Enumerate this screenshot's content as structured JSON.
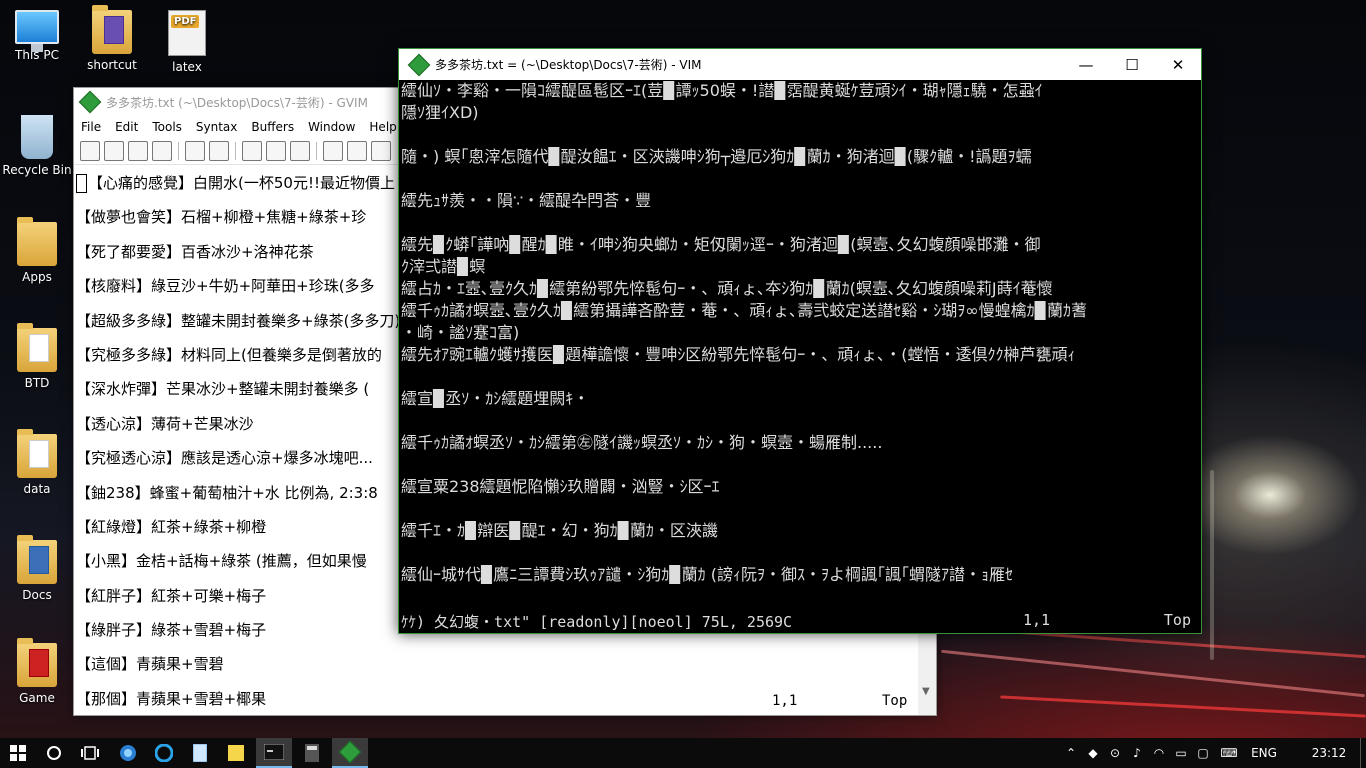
{
  "desktop": {
    "icons": [
      {
        "label": "This PC"
      },
      {
        "label": "shortcut"
      },
      {
        "label": "latex"
      },
      {
        "label": "Recycle Bin"
      },
      {
        "label": "Apps"
      },
      {
        "label": "BTD"
      },
      {
        "label": "data"
      },
      {
        "label": "Docs"
      },
      {
        "label": "Game"
      }
    ],
    "pdf_badge": "PDF"
  },
  "gvim": {
    "title": "多多茶坊.txt (~\\Desktop\\Docs\\7-芸術) - GVIM",
    "menu": [
      "File",
      "Edit",
      "Tools",
      "Syntax",
      "Buffers",
      "Window",
      "Help"
    ],
    "lines": [
      "【心痛的感覺】白開水(一杯50元!!最近物價上",
      "【做夢也會笑】石榴+柳橙+焦糖+綠茶+珍",
      "【死了都要愛】百香冰沙+洛神花茶",
      "【核廢料】綠豆沙+牛奶+阿華田+珍珠(多多",
      "【超級多多綠】整罐未開封養樂多+綠茶(多多刀)",
      "【究極多多綠】材料同上(但養樂多是倒著放的",
      "【深水炸彈】芒果冰沙+整罐未開封養樂多 (",
      "【透心涼】薄荷+芒果冰沙",
      "【究極透心涼】應該是透心涼+爆多冰塊吧...",
      "【鈾238】蜂蜜+葡萄柚汁+水 比例為, 2:3:8",
      "【紅綠燈】紅茶+綠茶+柳橙",
      "【小黑】金桔+話梅+綠茶 (推薦，但如果慢",
      "【紅胖子】紅茶+可樂+梅子",
      "【綠胖子】綠茶+雪碧+梅子",
      "【這個】青蘋果+雪碧",
      "【那個】青蘋果+雪碧+椰果"
    ],
    "status_pos": "1,1",
    "status_top": "Top"
  },
  "vim": {
    "title": "多多茶坊.txt = (~\\Desktop\\Docs\\7-芸術) - VIM",
    "minimize": "—",
    "maximize": "☐",
    "close": "✕",
    "lines": [
      "繧仙ｿ・李谿・一隕ｺ繧醍區髢区ｰｴ(荳▉譚ｯ50蜈・!譛▉霑醍黄蜒ｹ荳頑ｼｲ・瑚ｬ隱ｪ驍・怎蝨ｲ",
      "隱ｿ狸ｲXD)",
      "",
      "隨・) 螟｢悤滓怎隨代▉醍汝饂ｴ・区浹譏呻ｼ狗┬邉厄ｼ狗ｶ▉蘭ｶ・狗渚迴▉(驟ｸ轤・!譌題ｦ蠕",
      "",
      "繧先ｭｻ羨・・隕∵・繧醍卆閂荅・豐",
      "",
      "繧先▉ｸ蟒｢譁吶▉醒ｶ▉睢・ｲ呻ｼ狗央螂ｶ・矩仭闌ｯ逕ｰ・狗渚迴▉(螟壼､夂幻蝮顔噪邯灘・御",
      "ｸ滓弍譛▉螟",
      "繧占ｶ・ｴ壼､壹ｸ久ｶ▉繧第紛鄂先悴髢句ｰ・、頑ｨょ､夲ｼ狗ｶ▉蘭ｶ(螟壼､夂幻蝮顔噪莉J蒔ｲ菴懷",
      "繧千ｩｶ譎ｵ螟壼､壹ｸ久ｶ▉繧第攝譁吝酔荳・菴・、頑ｨょ､壽弐蛟定送譛ｾ谿・ｼ瑚ｦ∞慢蝗檎ｶ▉蘭ｶ蓍",
      "・崎・謐ｿ蹇ｺ富)",
      "繧先ｵｱ豌ｴ轤ｸ蠖ｻ擭医▉題樺譫懷・豐呻ｼ区紛鄂先悴髢句ｰ・、頑ｨょ､・(螳悟・逶倶ｸｸ榊芦甕頑ｨ",
      "",
      "繧宣▉丞ｿ・ｶｼ繧題埋闕ｷ・",
      "",
      "繧千ｩｶ譎ｵ螟丞ｿ・ｶｼ繧第㊧隧ｲ譏ｯ螟丞ｿ・ｶｼ・狗・螟壼・蝪雁制.....",
      "",
      "繧宣粟238繧題怩陷懶ｼ玖贈闢・汹豎・ｼ区ｰｴ",
      "",
      "繧千ｴ・ｶ▉辯医▉醍ｴ・幻・狗ｶ▉蘭ｶ・区浹譏",
      "",
      "繧仙ｰ城ｻ代▉鷹ﾆ三譚費ｼ玖ｩｱ譴・ｼ狗ｶ▉蘭ｶ (謗ｨ阮ｦ・御ｽ・ｦよ棡諷｢諷｢蝟隧ｱ譛・ｮ雁ｾ"
    ],
    "status_msg": "ｹｹ) 夂幻蝮・txt\" [readonly][noeol] 75L, 2569C",
    "status_pos": "1,1",
    "status_top": "Top"
  },
  "taskbar": {
    "start_icon": "windows-start-icon",
    "ime_indicator": "ENG",
    "time": "23:12"
  },
  "colors": {
    "vim_border": "#3a8f3a",
    "taskbar_bg": "#0b0b0b",
    "accent": "#76b9ed"
  }
}
